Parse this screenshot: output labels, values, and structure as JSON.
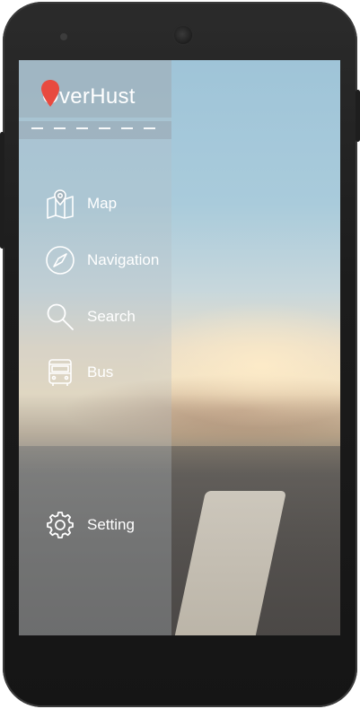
{
  "app": {
    "brand_name": "OverHust",
    "accent_color": "#e84a3f"
  },
  "menu": {
    "items": [
      {
        "label": "Map",
        "icon": "map-pin-icon"
      },
      {
        "label": "Navigation",
        "icon": "compass-icon"
      },
      {
        "label": "Search",
        "icon": "search-icon"
      },
      {
        "label": "Bus",
        "icon": "bus-icon"
      }
    ],
    "setting": {
      "label": "Setting",
      "icon": "gear-icon"
    }
  }
}
